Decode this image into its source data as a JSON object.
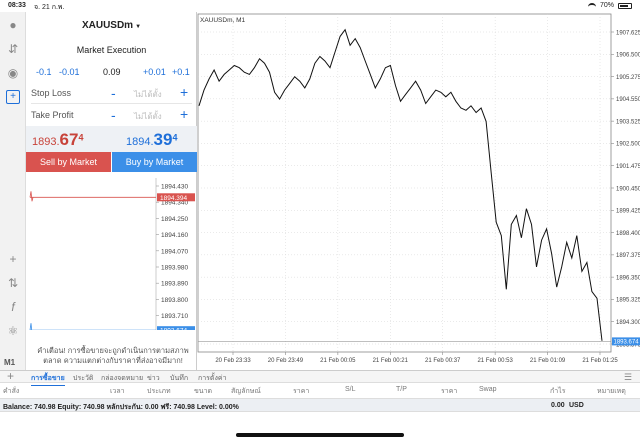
{
  "status": {
    "time": "08:33",
    "date": "จ. 21 ก.พ.",
    "battery": "70%"
  },
  "rail": {
    "label": "M1"
  },
  "order": {
    "symbol": "XAUUSDm",
    "execution": "Market Execution",
    "vol_steps": [
      "-0.1",
      "-0.01",
      "0.09",
      "+0.01",
      "+0.1"
    ],
    "stop_loss_label": "Stop Loss",
    "take_profit_label": "Take Profit",
    "not_set": "ไม่ได้ตั้ง",
    "minus": "-",
    "plus": "+",
    "bid": {
      "main": "1893.",
      "big": "67",
      "sup": "4"
    },
    "ask": {
      "main": "1894.",
      "big": "39",
      "sup": "4"
    },
    "sell_label": "Sell by Market",
    "buy_label": "Buy by Market",
    "warning": "คำเตือน! การซื้อขายจะถูกดำเนินการตามสภาพตลาด ความแตกต่างกับราคาที่ส่งอาจมีมาก!"
  },
  "mini_chart": {
    "ticks": [
      "1894.430",
      "1894.340",
      "1894.250",
      "1894.160",
      "1894.070",
      "1893.980",
      "1893.890",
      "1893.800",
      "1893.710"
    ],
    "ask_badge": "1894.394",
    "bid_badge": "1893.674",
    "ask_color": "#d9534f",
    "bid_color": "#3b8fe8"
  },
  "chart_data": {
    "type": "line",
    "title": "XAUUSDm, M1",
    "x_ticks": [
      "20 Feb 23:33",
      "20 Feb 23:49",
      "21 Feb 00:05",
      "21 Feb 00:21",
      "21 Feb 00:37",
      "21 Feb 00:53",
      "21 Feb 01:09",
      "21 Feb 01:25"
    ],
    "y_ticks": [
      "1907.625",
      "1906.500",
      "1905.275",
      "1904.550",
      "1903.525",
      "1902.500",
      "1901.475",
      "1900.450",
      "1899.425",
      "1898.400",
      "1897.375",
      "1896.350",
      "1895.325",
      "1894.300",
      "1893.375"
    ],
    "ylim": [
      1893.2,
      1908.3
    ],
    "values": [
      1904.2,
      1904.9,
      1905.4,
      1905.8,
      1905.3,
      1905.6,
      1905.8,
      1906.0,
      1905.9,
      1905.7,
      1905.6,
      1905.9,
      1906.3,
      1906.1,
      1905.7,
      1904.8,
      1904.5,
      1904.9,
      1905.2,
      1905.5,
      1905.3,
      1905.0,
      1905.4,
      1906.1,
      1906.4,
      1906.2,
      1905.9,
      1906.6,
      1907.3,
      1907.6,
      1906.9,
      1907.2,
      1906.8,
      1906.2,
      1905.6,
      1905.0,
      1905.4,
      1905.9,
      1906.0,
      1905.1,
      1904.4,
      1904.7,
      1905.0,
      1905.3,
      1904.9,
      1904.3,
      1904.6,
      1904.9,
      1904.8,
      1904.6,
      1904.8,
      1904.4,
      1904.1,
      1904.0,
      1904.2,
      1903.9,
      1904.1,
      1903.5,
      1901.2,
      1899.0,
      1898.4,
      1896.0,
      1898.9,
      1899.3,
      1898.3,
      1899.6,
      1898.9,
      1897.0,
      1898.2,
      1898.7,
      1897.6,
      1896.1,
      1897.0,
      1898.1,
      1897.4,
      1898.4,
      1896.8,
      1897.2,
      1895.9,
      1895.6,
      1893.7
    ],
    "last_price_badge": "1893.674",
    "last_price": 1893.674,
    "line_color": "#111111",
    "grid": true
  },
  "bottom": {
    "tabs": [
      "การซื้อขาย",
      "ประวัติ",
      "กล่องจดหมาย",
      "ข่าว",
      "บันทึก",
      "การตั้งค่า"
    ],
    "columns": [
      "คำสั่ง",
      "เวลา",
      "ประเภท",
      "ขนาด",
      "สัญลักษณ์",
      "ราคา",
      "S/L",
      "T/P",
      "ราคา",
      "Swap",
      "กำไร",
      "หมายเหตุ"
    ],
    "balance_text": "Balance: 740.98 Equity: 740.98 หลักประกัน: 0.00 ฟรี: 740.98 Level: 0.00%",
    "profit": "0.00",
    "currency": "USD"
  }
}
